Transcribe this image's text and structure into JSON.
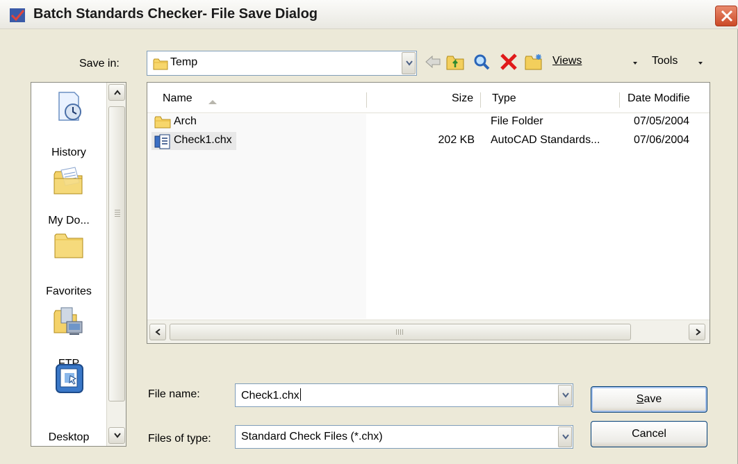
{
  "window": {
    "title": "Batch Standards Checker- File Save Dialog"
  },
  "save_in": {
    "label": "Save in:",
    "value": "Temp"
  },
  "toolbar": {
    "views_label": "Views",
    "tools_label": "Tools"
  },
  "places": [
    {
      "label": "History",
      "icon": "history-icon"
    },
    {
      "label": "My Do...",
      "icon": "my-documents-icon"
    },
    {
      "label": "Favorites",
      "icon": "favorites-icon"
    },
    {
      "label": "FTP",
      "icon": "ftp-icon"
    },
    {
      "label": "Desktop",
      "icon": "desktop-icon"
    }
  ],
  "file_list": {
    "columns": [
      "Name",
      "Size",
      "Type",
      "Date Modifie"
    ],
    "rows": [
      {
        "name": "Arch",
        "size": "",
        "type": "File Folder",
        "date": "07/05/2004",
        "icon": "folder-icon"
      },
      {
        "name": "Check1.chx",
        "size": "202 KB",
        "type": "AutoCAD Standards...",
        "date": "07/06/2004",
        "icon": "chx-file-icon"
      }
    ]
  },
  "file_name": {
    "label": "File name:",
    "value": "Check1.chx"
  },
  "file_type": {
    "label": "Files of type:",
    "value": "Standard Check Files (*.chx)"
  },
  "buttons": {
    "save_label_rest": "ave",
    "save_label_mnemonic": "S",
    "cancel_label": "Cancel"
  }
}
